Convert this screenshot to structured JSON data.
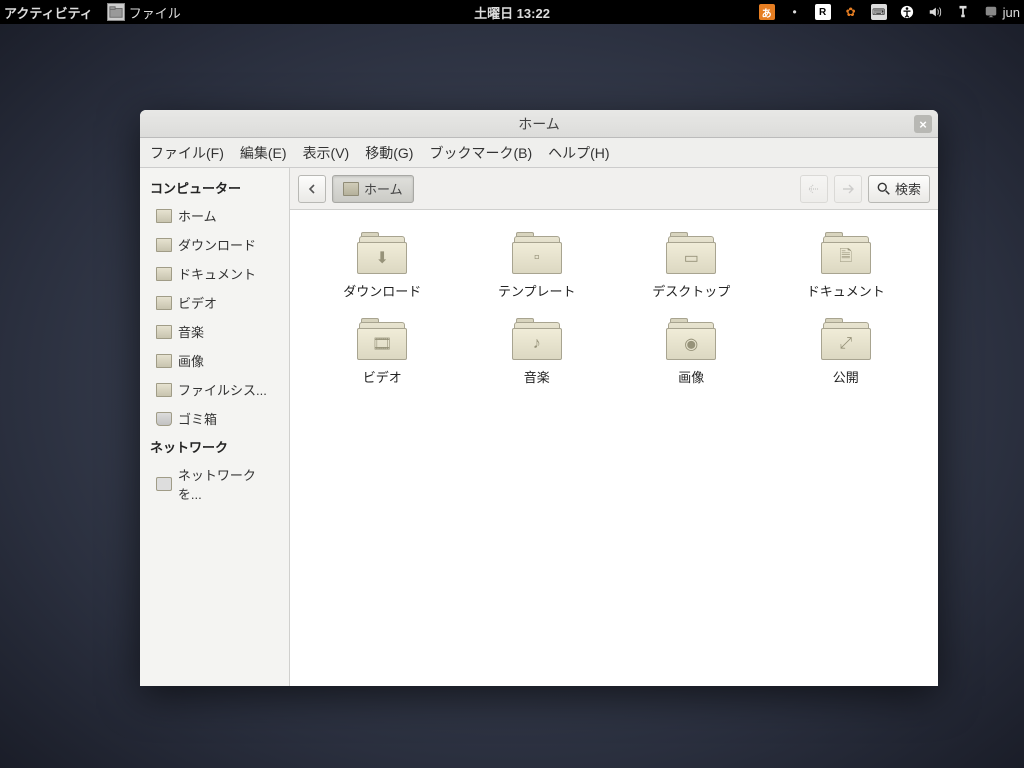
{
  "topbar": {
    "activities": "アクティビティ",
    "app_label": "ファイル",
    "clock": "土曜日 13:22",
    "user": "jun"
  },
  "window": {
    "title": "ホーム"
  },
  "menubar": {
    "file": "ファイル(F)",
    "edit": "編集(E)",
    "view": "表示(V)",
    "go": "移動(G)",
    "bookmarks": "ブックマーク(B)",
    "help": "ヘルプ(H)"
  },
  "sidebar": {
    "section_computer": "コンピューター",
    "home": "ホーム",
    "downloads": "ダウンロード",
    "documents": "ドキュメント",
    "videos": "ビデオ",
    "music": "音楽",
    "pictures": "画像",
    "filesystem": "ファイルシス...",
    "trash": "ゴミ箱",
    "section_network": "ネットワーク",
    "browse_network": "ネットワークを..."
  },
  "toolbar": {
    "path_home": "ホーム",
    "search_label": "検索"
  },
  "folders": {
    "downloads": "ダウンロード",
    "templates": "テンプレート",
    "desktop": "デスクトップ",
    "documents": "ドキュメント",
    "videos": "ビデオ",
    "music": "音楽",
    "pictures": "画像",
    "public": "公開"
  }
}
